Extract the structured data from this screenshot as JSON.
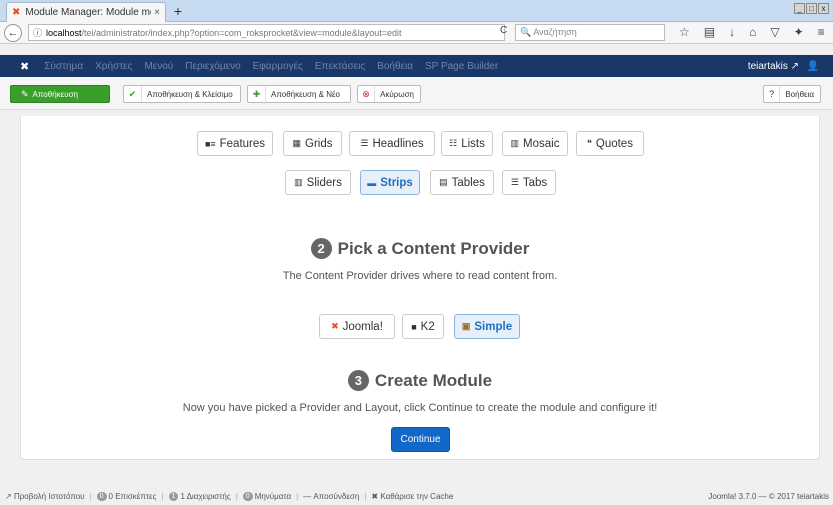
{
  "browser": {
    "tab_title": "Module Manager: Module mod_r",
    "tab_close": "×",
    "new_tab": "+",
    "url_host": "localhost",
    "url_path": "/tei/administrator/index.php?option=com_roksprocket&view=module&layout=edit",
    "search_placeholder": "Αναζήτηση",
    "win_min": "_",
    "win_max": "□",
    "win_close": "x"
  },
  "adminmenu": {
    "items": [
      "Σύστημα",
      "Χρήστες",
      "Μενού",
      "Περιεχόμενο",
      "Εφαρμογές",
      "Επεκτάσεις",
      "Βοήθεια",
      "SP Page Builder"
    ],
    "user": "teiartakis"
  },
  "toolbar": {
    "save": "Αποθήκευση",
    "save_close": "Αποθήκευση & Κλείσιμο",
    "save_new": "Αποθήκευση & Νέο",
    "cancel": "Ακύρωση",
    "help": "Βοήθεια"
  },
  "layouts": {
    "features": "Features",
    "grids": "Grids",
    "headlines": "Headlines",
    "lists": "Lists",
    "mosaic": "Mosaic",
    "quotes": "Quotes",
    "sliders": "Sliders",
    "strips": "Strips",
    "tables": "Tables",
    "tabs": "Tabs",
    "selected": "Strips"
  },
  "step2": {
    "number": "2",
    "title": "Pick a Content Provider",
    "desc": "The Content Provider drives where to read content from."
  },
  "providers": {
    "joomla": "Joomla!",
    "k2": "K2",
    "simple": "Simple",
    "selected": "Simple"
  },
  "step3": {
    "number": "3",
    "title": "Create Module",
    "desc": "Now you have picked a Provider and Layout, click Continue to create the module and configure it!",
    "button": "Continue"
  },
  "statusbar": {
    "preview": "Προβολή Ιστοτόπου",
    "visitors_count": "0",
    "visitors": "0 Επισκέπτες",
    "admins_count": "1",
    "admins": "1 Διαχειριστής",
    "messages_count": "0",
    "messages": "Μηνύματα",
    "logout": "Αποσύνδεση",
    "clear_cache": "Καθάρισε την Cache",
    "version": "Joomla! 3.7.0 — © 2017 teiartakis"
  },
  "colors": {
    "admin_menu_bg": "#1a3867",
    "save_green": "#3a9e2b",
    "continue_blue": "#1268c8",
    "active_layout": "#e6f0fb"
  }
}
